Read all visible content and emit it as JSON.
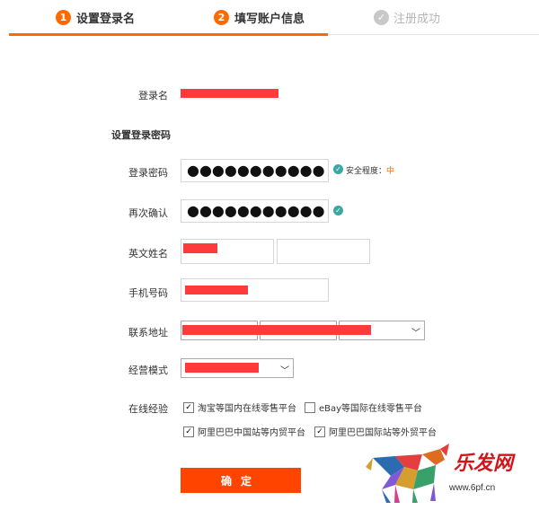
{
  "steps": [
    {
      "num": "1",
      "label": "设置登录名"
    },
    {
      "num": "2",
      "label": "填写账户信息"
    },
    {
      "num": "✓",
      "label": "注册成功"
    }
  ],
  "form": {
    "login_name_label": "登录名",
    "set_password_section": "设置登录密码",
    "password_label": "登录密码",
    "password_value": "●●●●●●●●●●●",
    "strength_label": "安全程度：",
    "strength_level": "中",
    "confirm_label": "再次确认",
    "confirm_value": "●●●●●●●●●●●",
    "english_name_label": "英文姓名",
    "phone_label": "手机号码",
    "address_label": "联系地址",
    "business_label": "经营模式",
    "online_exp_label": "在线经验",
    "options": [
      {
        "label": "淘宝等国内在线零售平台",
        "checked": true
      },
      {
        "label": "eBay等国际在线零售平台",
        "checked": false
      },
      {
        "label": "阿里巴巴中国站等内贸平台",
        "checked": true
      },
      {
        "label": "阿里巴巴国际站等外贸平台",
        "checked": true
      }
    ],
    "submit_label": "确定"
  },
  "watermark": {
    "brand": "乐发网",
    "url": "www.6pf.cn"
  },
  "colors": {
    "accent": "#ff6a00",
    "button": "#ff4400",
    "redaction": "#ff3a3a",
    "check": "#3aa8a0"
  }
}
